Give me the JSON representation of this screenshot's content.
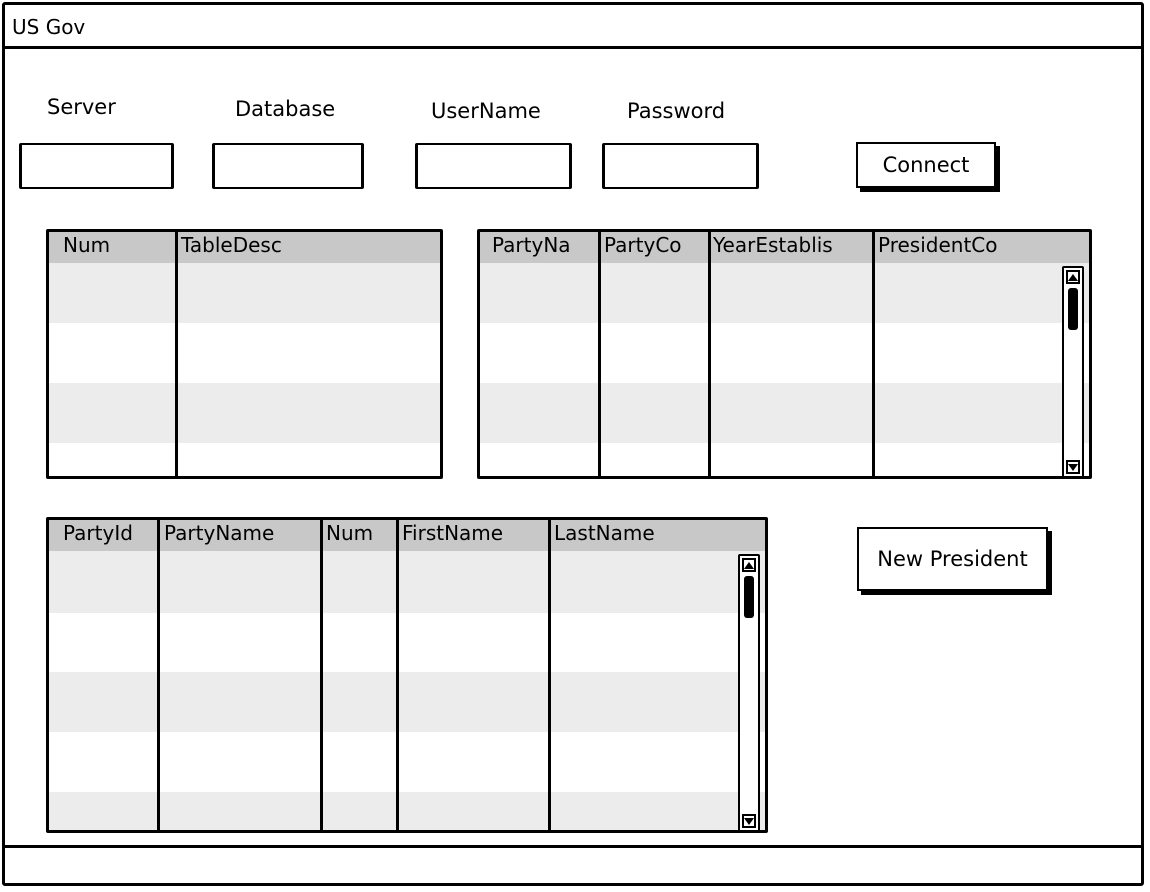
{
  "window": {
    "title": "US Gov"
  },
  "connection": {
    "labels": {
      "server": "Server",
      "database": "Database",
      "username": "UserName",
      "password": "Password"
    },
    "values": {
      "server": "",
      "database": "",
      "username": "",
      "password": ""
    },
    "connect_label": "Connect"
  },
  "tables_grid": {
    "columns": [
      "Num",
      "TableDesc"
    ],
    "rows": []
  },
  "parties_grid": {
    "columns": [
      "PartyNa",
      "PartyCo",
      "YearEstablis",
      "PresidentCo"
    ],
    "rows": []
  },
  "presidents_grid": {
    "columns": [
      "PartyId",
      "PartyName",
      "Num",
      "FirstName",
      "LastName"
    ],
    "rows": []
  },
  "actions": {
    "new_president_label": "New President"
  },
  "colors": {
    "header_bg": "#c8c8c8",
    "band_bg": "#ececec",
    "border": "#000000"
  }
}
